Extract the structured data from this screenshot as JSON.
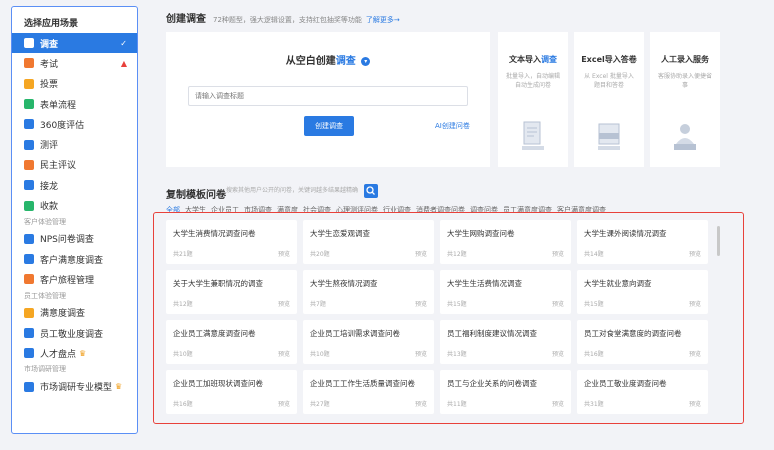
{
  "sidebar": {
    "title": "选择应用场景",
    "items": [
      {
        "label": "调查",
        "icon": "survey-icon",
        "color": "#ffffff",
        "active": true,
        "trail": "✓"
      },
      {
        "label": "考试",
        "icon": "exam-icon",
        "color": "#f07830",
        "trail": "▲"
      },
      {
        "label": "投票",
        "icon": "vote-icon",
        "color": "#f5a623"
      },
      {
        "label": "表单流程",
        "icon": "form-icon",
        "color": "#27b66b"
      },
      {
        "label": "360度评估",
        "icon": "assessment-icon",
        "color": "#2a7ae2"
      },
      {
        "label": "测评",
        "icon": "test-icon",
        "color": "#2a7ae2"
      },
      {
        "label": "民主评议",
        "icon": "review-icon",
        "color": "#f07830"
      },
      {
        "label": "接龙",
        "icon": "relay-icon",
        "color": "#2a7ae2"
      },
      {
        "label": "收款",
        "icon": "payment-icon",
        "color": "#27b66b"
      }
    ],
    "group1": "客户体验管理",
    "group1_items": [
      {
        "label": "NPS问卷调查",
        "icon": "nps-icon",
        "color": "#2a7ae2"
      },
      {
        "label": "客户满意度调查",
        "icon": "customer-satisfaction-icon",
        "color": "#2a7ae2"
      },
      {
        "label": "客户旅程管理",
        "icon": "journey-icon",
        "color": "#f07830"
      }
    ],
    "group2": "员工体验管理",
    "group2_items": [
      {
        "label": "满意度调查",
        "icon": "satisfaction-icon",
        "color": "#f5a623"
      },
      {
        "label": "员工敬业度调查",
        "icon": "engagement-icon",
        "color": "#2a7ae2"
      },
      {
        "label": "人才盘点",
        "icon": "talent-icon",
        "color": "#2a7ae2",
        "crown": "♛"
      }
    ],
    "group3": "市场调研管理",
    "group3_items": [
      {
        "label": "市场调研专业模型",
        "icon": "market-model-icon",
        "color": "#2a7ae2",
        "crown": "♛"
      }
    ]
  },
  "create": {
    "heading": "创建调查",
    "subtitle": "72种题型，强大逻辑设置，支持红包抽奖等功能",
    "learn_more": "了解更多→",
    "card_title_prefix": "从空白创建",
    "card_title_highlight": "调查",
    "input_placeholder": "请输入调查标题",
    "button": "创建调查",
    "ai_link": "AI创建问卷"
  },
  "side_cards": [
    {
      "title_prefix": "文本导入",
      "title_highlight": "调查",
      "desc": "批量导入，自动编辑自动生成问卷",
      "icon": "text-import-icon"
    },
    {
      "title_prefix": "Excel导入答卷",
      "title_highlight": "",
      "desc": "从 Excel 批量导入题目和答卷",
      "icon": "excel-import-icon"
    },
    {
      "title_prefix": "人工录入服务",
      "title_highlight": "",
      "desc": "客服协助录入便捷省事",
      "icon": "manual-entry-icon"
    }
  ],
  "templates": {
    "heading": "复制模板问卷",
    "search_placeholder": "搜索其他用户公开的问卷，关键词越多结果越精确",
    "tags": [
      "全部",
      "大学生",
      "企业员工",
      "市场调查",
      "满意度",
      "社会调查",
      "心理测评问卷",
      "行业调查",
      "消费者调查问卷",
      "调查问卷",
      "员工满意度调查",
      "客户满意度调查"
    ],
    "cards": [
      {
        "name": "大学生消费情况调查问卷",
        "count": "共21题",
        "preview": "预览"
      },
      {
        "name": "大学生恋爱观调查",
        "count": "共20题",
        "preview": "预览"
      },
      {
        "name": "大学生网购调查问卷",
        "count": "共12题",
        "preview": "预览"
      },
      {
        "name": "大学生课外阅读情况调查",
        "count": "共14题",
        "preview": "预览"
      },
      {
        "name": "关于大学生兼职情况的调查",
        "count": "共12题",
        "preview": "预览"
      },
      {
        "name": "大学生熬夜情况调查",
        "count": "共7题",
        "preview": "预览"
      },
      {
        "name": "大学生生活费情况调查",
        "count": "共15题",
        "preview": "预览"
      },
      {
        "name": "大学生就业意向调查",
        "count": "共15题",
        "preview": "预览"
      },
      {
        "name": "企业员工满意度调查问卷",
        "count": "共10题",
        "preview": "预览"
      },
      {
        "name": "企业员工培训需求调查问卷",
        "count": "共10题",
        "preview": "预览"
      },
      {
        "name": "员工福利制度建议情况调查",
        "count": "共13题",
        "preview": "预览"
      },
      {
        "name": "员工对食堂满意度的调查问卷",
        "count": "共16题",
        "preview": "预览"
      },
      {
        "name": "企业员工加班现状调查问卷",
        "count": "共16题",
        "preview": "预览"
      },
      {
        "name": "企业员工工作生活质量调查问卷",
        "count": "共27题",
        "preview": "预览"
      },
      {
        "name": "员工与企业关系的问卷调查",
        "count": "共11题",
        "preview": "预览"
      },
      {
        "name": "企业员工敬业度调查问卷",
        "count": "共31题",
        "preview": "预览"
      }
    ]
  },
  "colors": {
    "accent": "#2a7ae2",
    "highlight_border": "#e8413b"
  }
}
